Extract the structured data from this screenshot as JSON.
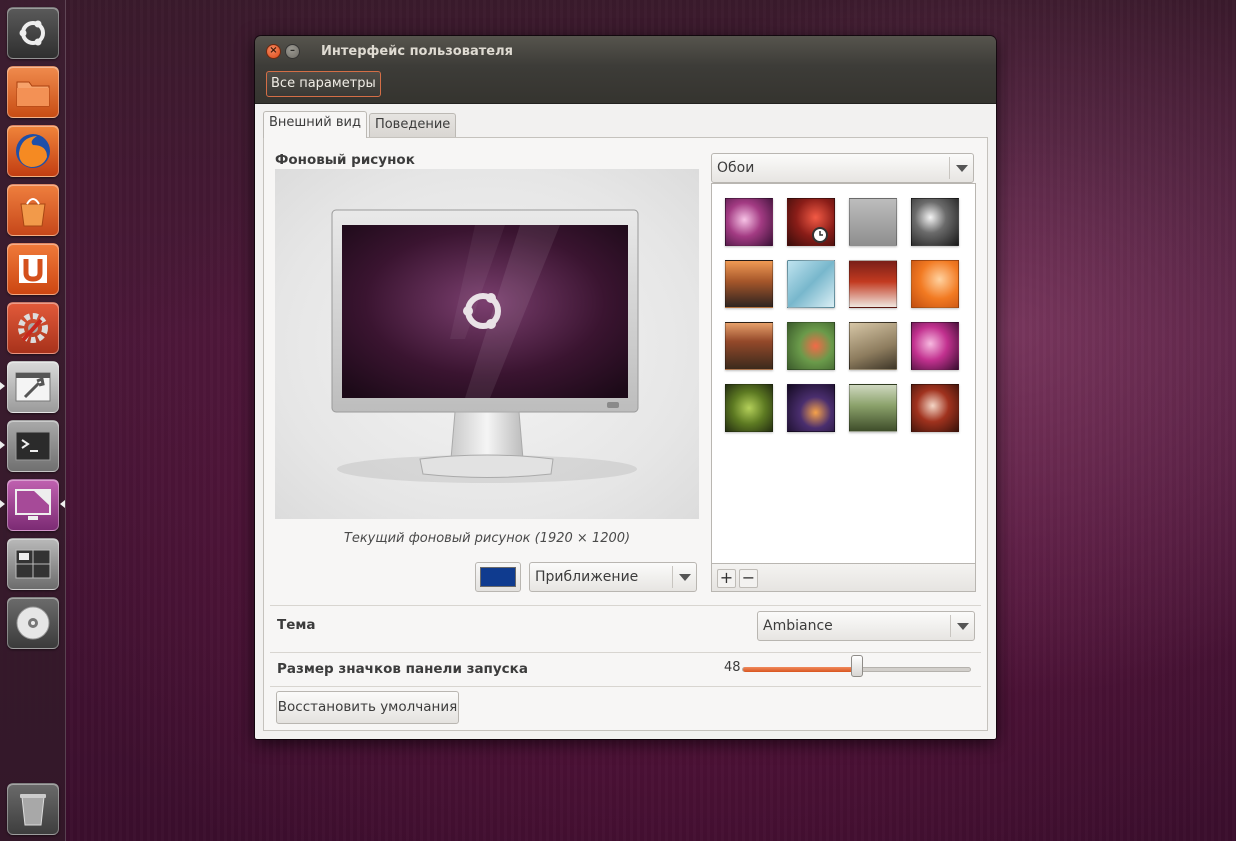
{
  "launcher": {
    "items": [
      {
        "name": "dash-home-icon"
      },
      {
        "name": "home-folder-icon"
      },
      {
        "name": "firefox-icon"
      },
      {
        "name": "software-center-icon"
      },
      {
        "name": "ubuntu-one-icon"
      },
      {
        "name": "system-settings-icon"
      },
      {
        "name": "settings-window-icon"
      },
      {
        "name": "terminal-icon"
      },
      {
        "name": "appearance-icon"
      },
      {
        "name": "workspace-switcher-icon"
      },
      {
        "name": "optical-disc-icon"
      },
      {
        "name": "trash-icon"
      }
    ]
  },
  "window": {
    "title": "Интерфейс пользователя",
    "close_glyph": "×",
    "minimize_glyph": "–",
    "all_settings_label": "Все параметры",
    "tabs": [
      {
        "label": "Внешний вид",
        "active": true
      },
      {
        "label": "Поведение",
        "active": false
      }
    ],
    "background_section": {
      "label": "Фоновый рисунок",
      "caption": "Текущий фоновый рисунок (1920 × 1200)",
      "source_combo": "Обои",
      "color": "#0f3b8f",
      "mode_combo": "Приближение",
      "add_glyph": "+",
      "remove_glyph": "−",
      "wallpapers": [
        {
          "name": "wallpaper-purple-bokeh",
          "selected": false
        },
        {
          "name": "wallpaper-red-flowers",
          "selected": true
        },
        {
          "name": "wallpaper-grey-deer",
          "selected": false
        },
        {
          "name": "wallpaper-bw-abstract",
          "selected": false
        },
        {
          "name": "wallpaper-sunset-road",
          "selected": false
        },
        {
          "name": "wallpaper-blue-ice",
          "selected": false
        },
        {
          "name": "wallpaper-autumn-path",
          "selected": false
        },
        {
          "name": "wallpaper-orange-leaves",
          "selected": false
        },
        {
          "name": "wallpaper-canyon",
          "selected": false
        },
        {
          "name": "wallpaper-green-flowers",
          "selected": false
        },
        {
          "name": "wallpaper-pen-paper",
          "selected": false
        },
        {
          "name": "wallpaper-magenta-flower",
          "selected": false
        },
        {
          "name": "wallpaper-green-bokeh",
          "selected": false
        },
        {
          "name": "wallpaper-night-horse",
          "selected": false
        },
        {
          "name": "wallpaper-grass",
          "selected": false
        },
        {
          "name": "wallpaper-red-chain",
          "selected": false
        }
      ]
    },
    "theme": {
      "label": "Тема",
      "value": "Ambiance"
    },
    "launcher_icon_size": {
      "label": "Размер значков панели запуска",
      "value": "48",
      "fraction": 0.5
    },
    "reset_label": "Восстановить умолчания"
  }
}
